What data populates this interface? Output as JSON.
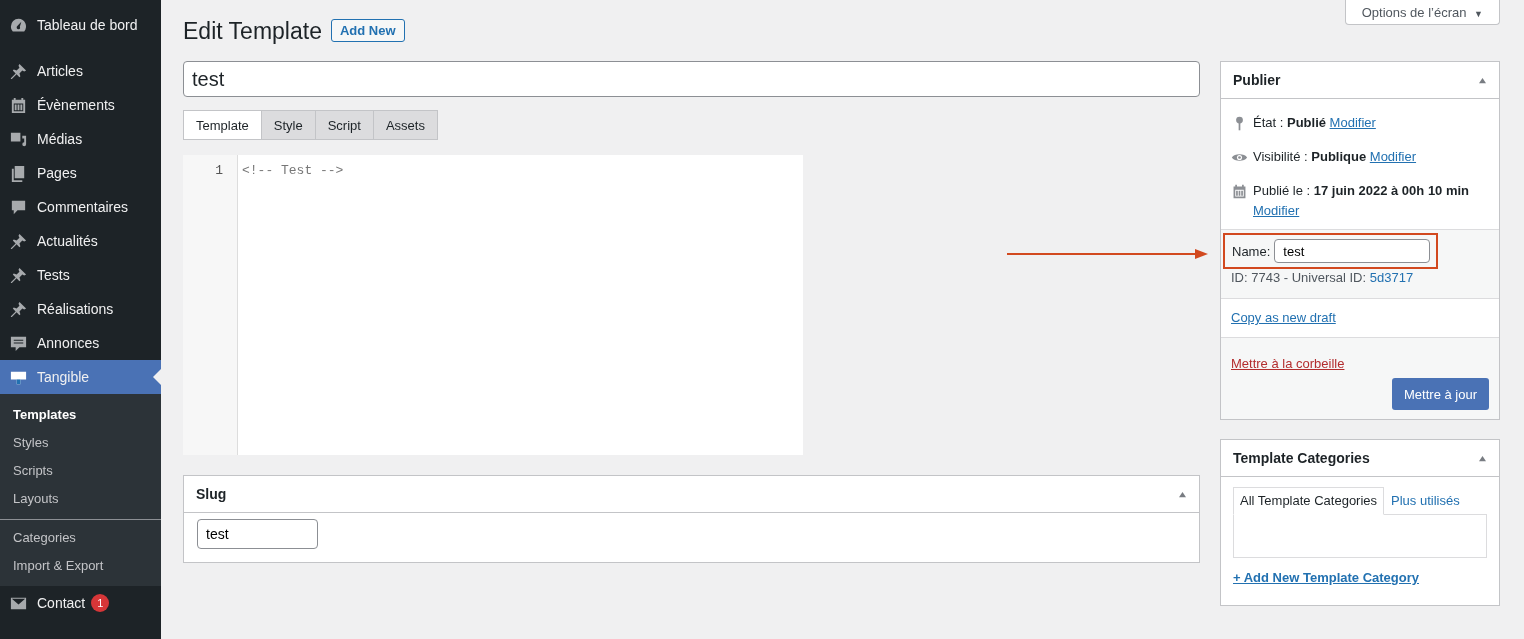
{
  "sidebar": {
    "items": [
      {
        "label": "Tableau de bord",
        "selected": false
      },
      {
        "label": "Articles",
        "selected": false
      },
      {
        "label": "Évènements",
        "selected": false
      },
      {
        "label": "Médias",
        "selected": false
      },
      {
        "label": "Pages",
        "selected": false
      },
      {
        "label": "Commentaires",
        "selected": false
      },
      {
        "label": "Actualités",
        "selected": false
      },
      {
        "label": "Tests",
        "selected": false
      },
      {
        "label": "Réalisations",
        "selected": false
      },
      {
        "label": "Annonces",
        "selected": false
      },
      {
        "label": "Tangible",
        "selected": true,
        "submenu_groups": [
          {
            "items": [
              {
                "label": "Templates",
                "selected": true
              },
              {
                "label": "Styles",
                "selected": false
              },
              {
                "label": "Scripts",
                "selected": false
              },
              {
                "label": "Layouts",
                "selected": false
              }
            ]
          },
          {
            "items": [
              {
                "label": "Categories",
                "selected": false
              },
              {
                "label": "Import & Export",
                "selected": false
              }
            ]
          }
        ]
      },
      {
        "label": "Contact",
        "selected": false,
        "badge": "1"
      }
    ]
  },
  "screen_options": {
    "label": "Options de l’écran",
    "caret": "▼"
  },
  "header": {
    "title": "Edit Template",
    "add_new": "Add New"
  },
  "title_field": {
    "value": "test"
  },
  "editor": {
    "tabs": [
      {
        "label": "Template",
        "selected": true
      },
      {
        "label": "Style",
        "selected": false
      },
      {
        "label": "Script",
        "selected": false
      },
      {
        "label": "Assets",
        "selected": false
      }
    ],
    "lines": [
      {
        "number": "1",
        "code": "<!-- Test -->"
      }
    ]
  },
  "slug": {
    "title": "Slug",
    "value": "test"
  },
  "publish": {
    "title": "Publier",
    "rows": [
      {
        "kind": "status",
        "text": "État : **Publié**",
        "link": "Modifier"
      },
      {
        "kind": "visibility",
        "text": "Visibilité : **Publique**",
        "link": "Modifier"
      },
      {
        "kind": "date",
        "text": "Publié le : **17 juin 2022 à 00h 10 min**",
        "link": "Modifier"
      }
    ],
    "name_label": "Name:",
    "name_value": "test",
    "id_text": "ID: 7743 - Universal ID:",
    "uid": "5d3717",
    "copy_link": "Copy as new draft",
    "trash_link": "Mettre à la corbeille",
    "update_button": "Mettre à jour"
  },
  "categories": {
    "title": "Template Categories",
    "tabs": [
      {
        "label": "All Template Categories",
        "selected": true
      },
      {
        "label": "Plus utilisés",
        "selected": false
      }
    ],
    "add_link": "+ Add New Template Category"
  }
}
